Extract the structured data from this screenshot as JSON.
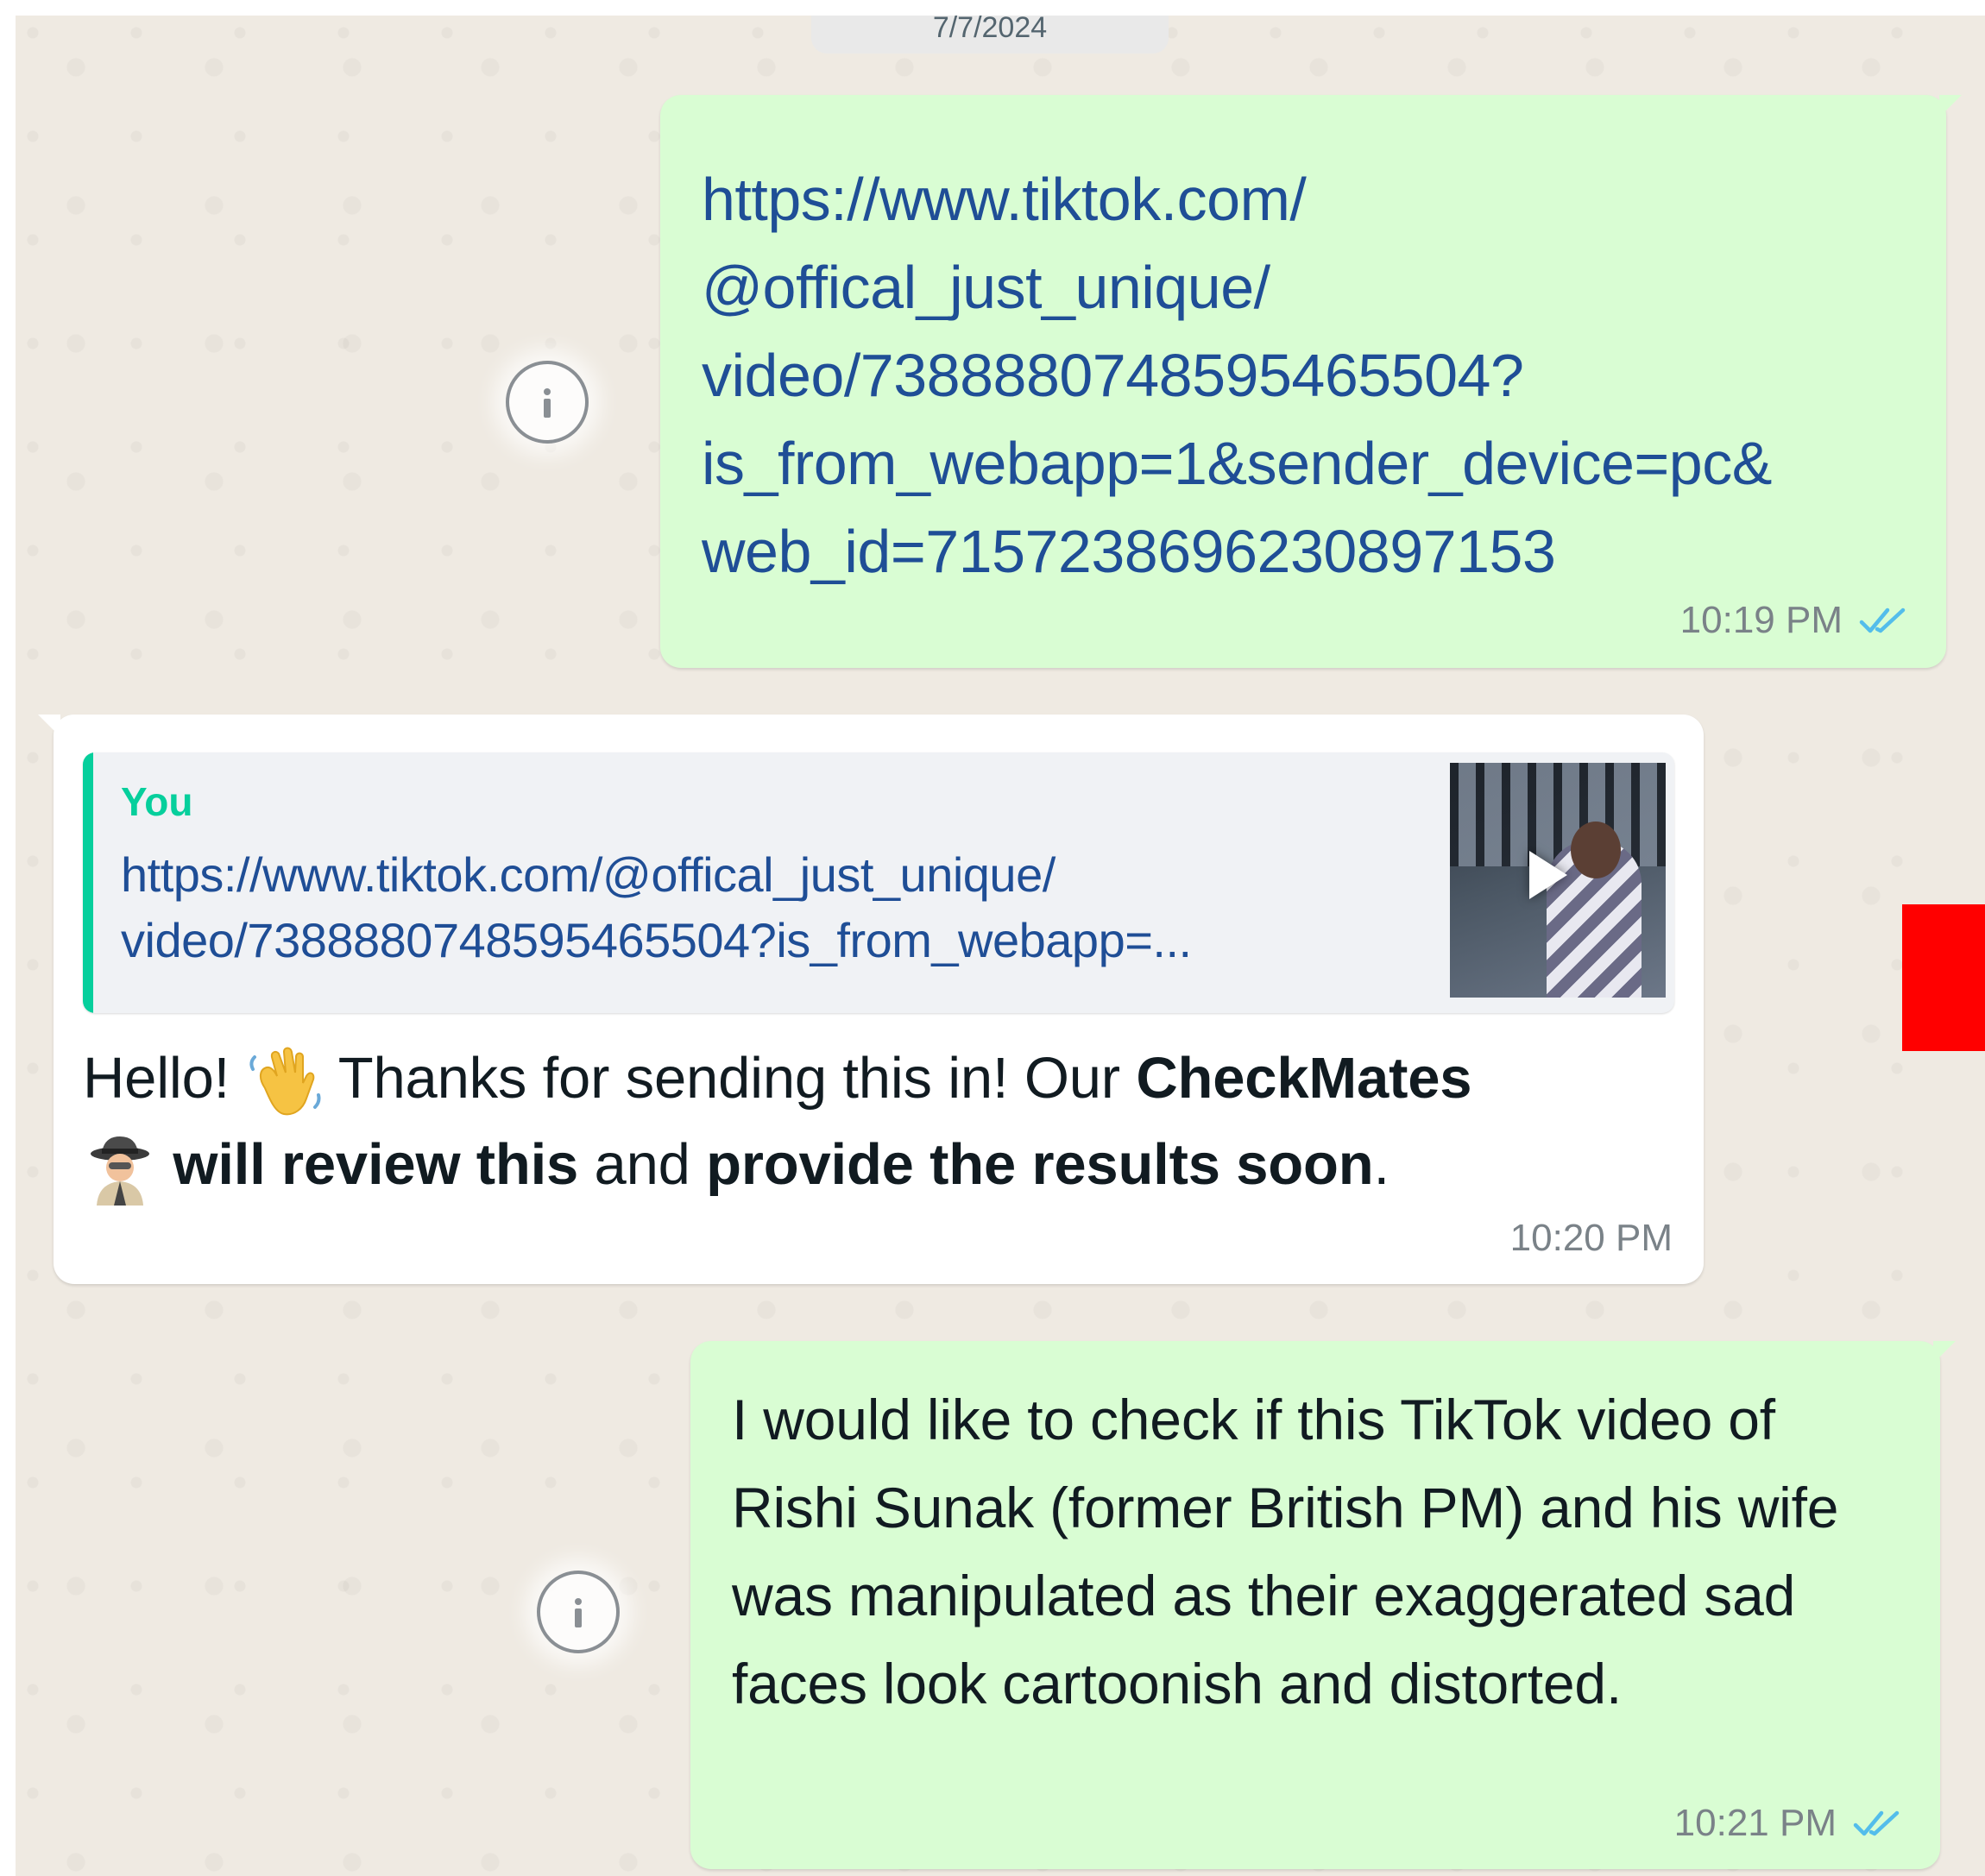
{
  "date_separator": "7/7/2024",
  "messages": [
    {
      "direction": "outgoing",
      "text": "https://www.tiktok.com/\n@offical_just_unique/\nvideo/7388880748595465504?\nis_from_webapp=1&sender_device=pc&\nweb_id=7157238696230897153",
      "time": "10:19 PM",
      "status": "read"
    },
    {
      "direction": "incoming",
      "quote": {
        "author": "You",
        "line1": "https://www.tiktok.com/@offical_just_unique/",
        "line2": "video/7388880748595465504?is_from_webapp=..."
      },
      "parts": {
        "p1": "Hello! ",
        "p2": " Thanks for sending this in! Our ",
        "b1": "CheckMates",
        "b2": " will review this",
        "p3": " and ",
        "b3": "provide the results soon",
        "p4": "."
      },
      "time": "10:20 PM"
    },
    {
      "direction": "outgoing",
      "text": "I would like to check if this TikTok video of Rishi Sunak (former British PM) and his wife was manipulated as their exaggerated sad faces look cartoonish and distorted.",
      "time": "10:21 PM",
      "status": "read"
    }
  ],
  "icons": {
    "info": "info-icon",
    "read": "double-check-icon",
    "play": "play-icon",
    "wave": "waving-hand-emoji",
    "detective": "detective-emoji"
  },
  "colors": {
    "outgoing_bubble": "#d9fdd3",
    "incoming_bubble": "#ffffff",
    "link": "#1f4e96",
    "quote_accent": "#06cf9c",
    "read_ticks": "#53bdeb",
    "chat_background": "#efeae2"
  }
}
